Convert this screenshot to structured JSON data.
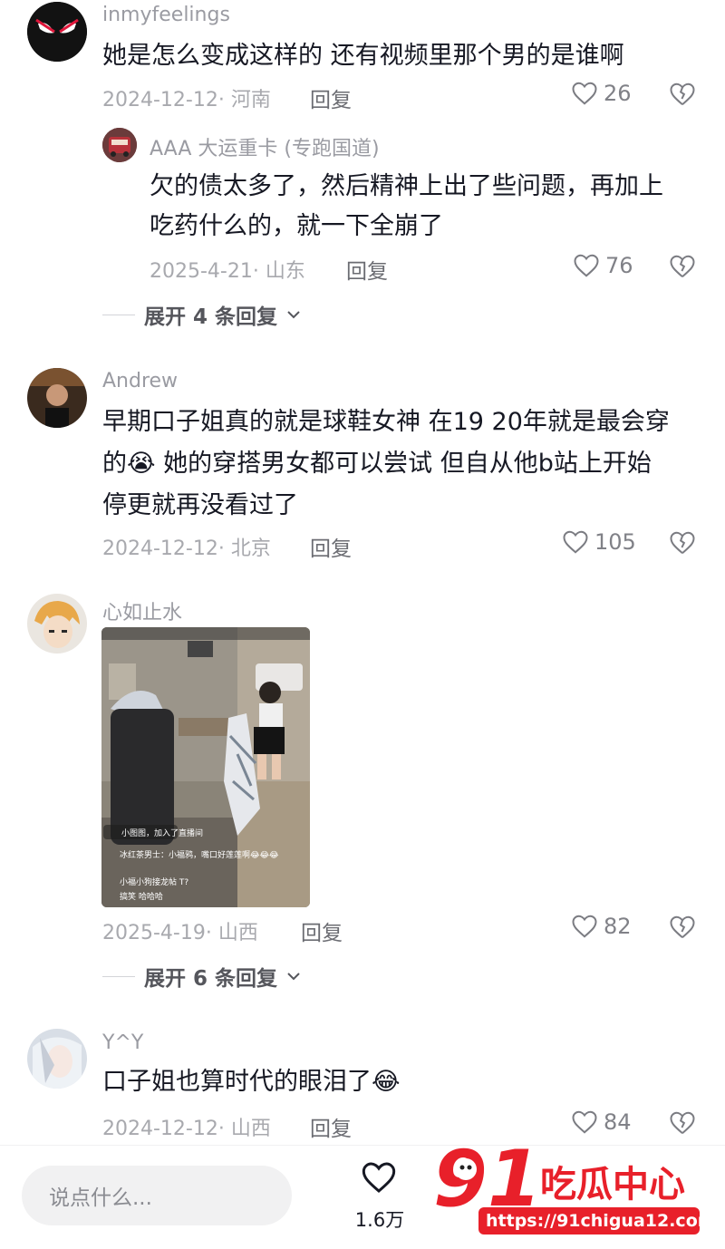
{
  "comments": [
    {
      "username": "inmyfeelings",
      "text": "她是怎么变成这样的 还有视频里那个男的是谁啊",
      "date_location": "2024-12-12· 河南",
      "reply_label": "回复",
      "likes": "26",
      "replies": [
        {
          "username": "AAA 大运重卡 (专跑国道)",
          "text_lines": [
            "欠的债太多了，然后精神上出了些问题，再加上",
            "吃药什么的，就一下全崩了"
          ],
          "date_location": "2025-4-21· 山东",
          "reply_label": "回复",
          "likes": "76"
        }
      ],
      "expand_label": "展开 4 条回复"
    },
    {
      "username": "Andrew",
      "text_lines": [
        "早期口子姐真的就是球鞋女神 在19 20年就是最会穿",
        "的😭 她的穿搭男女都可以尝试 但自从他b站上开始",
        "停更就再没看过了"
      ],
      "date_location": "2024-12-12· 北京",
      "reply_label": "回复",
      "likes": "105"
    },
    {
      "username": "心如止水",
      "image_overlay": {
        "chat_1": "小图图，加入了直播间",
        "chat_2": "冰红茶男士：小福鸦，嘴口好莲莲啊😂😂😂",
        "chat_3": "小福小狗接龙帖 T?",
        "chat_4": "搞笑 哈哈哈"
      },
      "date_location": "2025-4-19· 山西",
      "reply_label": "回复",
      "likes": "82",
      "expand_label": "展开 6 条回复"
    },
    {
      "username": "Y^Y",
      "text": "口子姐也算时代的眼泪了😂",
      "date_location": "2024-12-12· 山西",
      "reply_label": "回复",
      "likes": "84"
    }
  ],
  "bottom_bar": {
    "input_placeholder": "说点什么...",
    "like_count": "1.6万"
  },
  "watermark": {
    "logo": "91吃瓜中心",
    "url": "https://91chigua12.com"
  },
  "colors": {
    "watermark_red": "#e8202a",
    "text_primary": "#161823",
    "text_secondary": "#9a9ba2"
  }
}
